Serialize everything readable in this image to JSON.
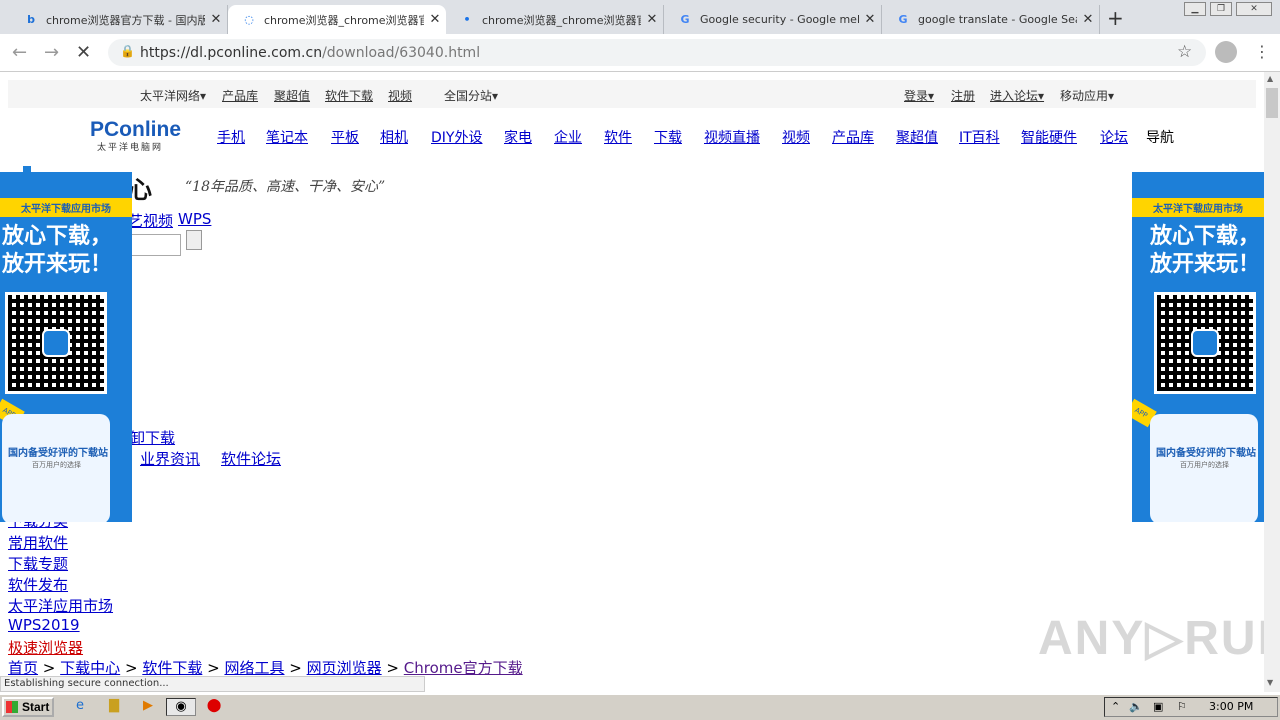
{
  "browser": {
    "tabs": [
      {
        "icon": "b",
        "title": "chrome浏览器官方下载 - 国内版",
        "close": "✕"
      },
      {
        "icon": "◌",
        "title": "chrome浏览器_chrome浏览器官",
        "close": "✕"
      },
      {
        "icon": "•",
        "title": "chrome浏览器_chrome浏览器官",
        "close": "✕"
      },
      {
        "icon": "G",
        "title": "Google security - Google meklēš",
        "close": "✕"
      },
      {
        "icon": "G",
        "title": "google translate - Google Search",
        "close": "✕"
      }
    ],
    "new_tab": "+",
    "url_host": "https://dl.pconline.com.cn",
    "url_path": "/download/63040.html"
  },
  "site": {
    "topbar": {
      "left": [
        "太平洋网络",
        "产品库",
        "聚超值",
        "软件下载",
        "视频"
      ],
      "branch": "全国分站",
      "right": [
        "登录",
        "注册",
        "进入论坛",
        "移动应用"
      ]
    },
    "logo": "PConline",
    "logo_sub": "太平洋电脑网",
    "nav": [
      "手机",
      "笔记本",
      "平板",
      "相机",
      "DIY外设",
      "家电",
      "企业",
      "软件",
      "下载",
      "视频直播",
      "视频",
      "产品库",
      "聚超值",
      "IT百科",
      "智能硬件",
      "论坛",
      "导航"
    ],
    "header_big": "心",
    "slogan": "“18年品质、高速、干净、安心”",
    "links_row1": [
      "艺视频",
      "WPS"
    ],
    "links_mid": "卸下载",
    "links_row2": [
      "业界资讯",
      "软件论坛"
    ],
    "side_links": [
      "下载分类",
      "常用软件",
      "下载专题",
      "软件发布",
      "太平洋应用市场",
      "WPS2019",
      "极速浏览器"
    ],
    "breadcrumb": [
      "首页",
      ">",
      "下载中心",
      ">",
      "软件下载",
      ">",
      "网络工具",
      ">",
      "网页浏览器",
      ">",
      "Chrome官方下载"
    ],
    "ad": {
      "tag": "太平洋下载应用市场",
      "line1": "放心下载，",
      "line2": "放开来玩！",
      "phone_title": "国内备受好评的下载站",
      "phone_sub": "百万用户的选择",
      "corner": "APP"
    },
    "watermark": "ANY▷RUN"
  },
  "status": "Establishing secure connection...",
  "taskbar": {
    "start": "Start",
    "time": "3:00 PM"
  },
  "colors": {
    "link": "#0000cc",
    "ad_blue": "#1d7fd8",
    "ad_yellow": "#ffd400",
    "logo": "#1a5bb8"
  }
}
